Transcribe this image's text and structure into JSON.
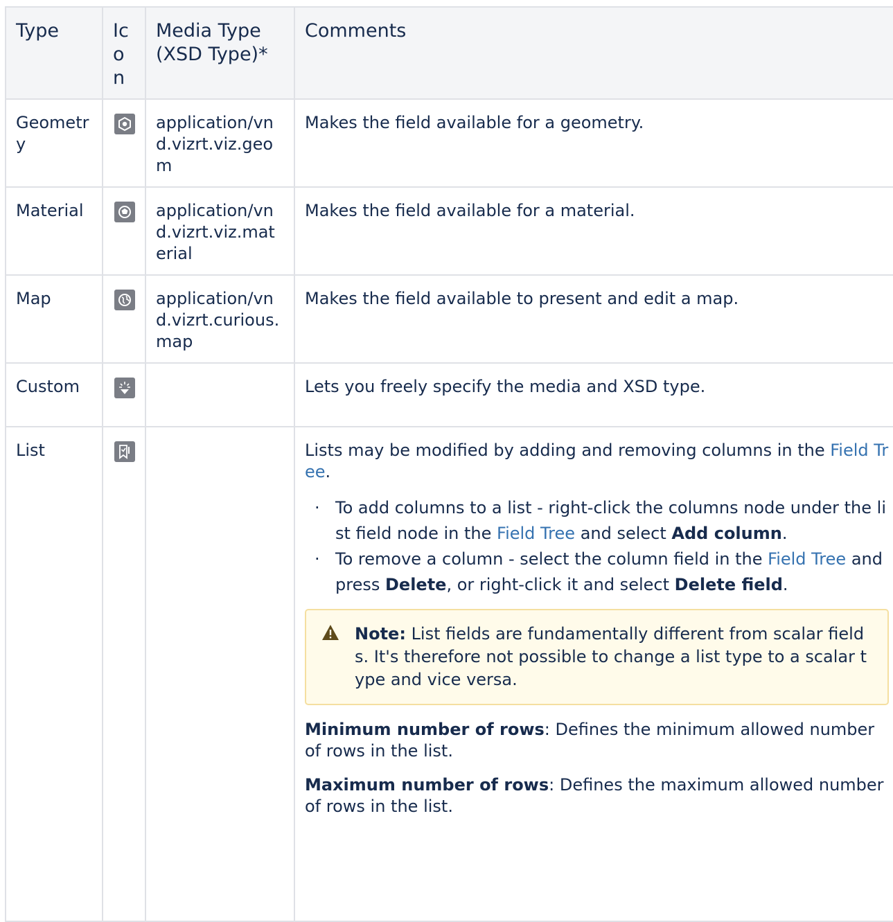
{
  "table": {
    "headers": {
      "type": "Type",
      "icon": "Ic o n",
      "media": "Media Type (XSD Type)*",
      "comments": "Comments"
    },
    "rows": [
      {
        "type": "Geometry",
        "icon": "geometry-icon",
        "media": "application/vnd.vizrt.viz.geom",
        "comment": "Makes the field available for a geometry."
      },
      {
        "type": "Material",
        "icon": "material-icon",
        "media": "application/vnd.vizrt.viz.material",
        "comment": "Makes the field available for a material."
      },
      {
        "type": "Map",
        "icon": "globe-icon",
        "media": "application/vnd.vizrt.curious.map",
        "comment": "Makes the field available to present and edit a map."
      },
      {
        "type": "Custom",
        "icon": "custom-icon",
        "media": "",
        "comment": "Lets you freely specify the media and XSD type."
      },
      {
        "type": "List",
        "icon": "list-icon",
        "media": ""
      }
    ],
    "list_details": {
      "intro_text": "Lists may be modified by adding and removing columns in the",
      "intro_link": "Field Tree",
      "intro_end": ".",
      "bullet1": {
        "text1": "To add columns to a list -  right-click the columns node under the list field node in the",
        "link": "Field Tree",
        "text2": "and select",
        "bold": "Add column",
        "end": "."
      },
      "bullet2": {
        "text1": "To remove a column - select the column field in the",
        "link": "Field Tree",
        "text2": "and press",
        "bold1": "Delete",
        "text3": ", or right-click it and select",
        "bold2": "Delete field",
        "end": "."
      },
      "note": {
        "label": "Note:",
        "text": "List fields are fundamentally different from scalar fields. It's therefore not possible to change a list type to a scalar type and vice versa.",
        "icon": "warning-icon"
      },
      "min_rows": {
        "label": "Minimum number of rows",
        "text": ": Defines the minimum allowed number of rows in the list."
      },
      "max_rows": {
        "label": "Maximum number of rows",
        "text": ": Defines the maximum allowed number of rows in the list."
      }
    }
  },
  "colors": {
    "link": "#3572b0",
    "border": "#dfe1e6",
    "header_bg": "#f4f5f7",
    "note_bg": "#fffbea",
    "note_border": "#f5dfa0",
    "icon_bg": "#7a7d85"
  }
}
